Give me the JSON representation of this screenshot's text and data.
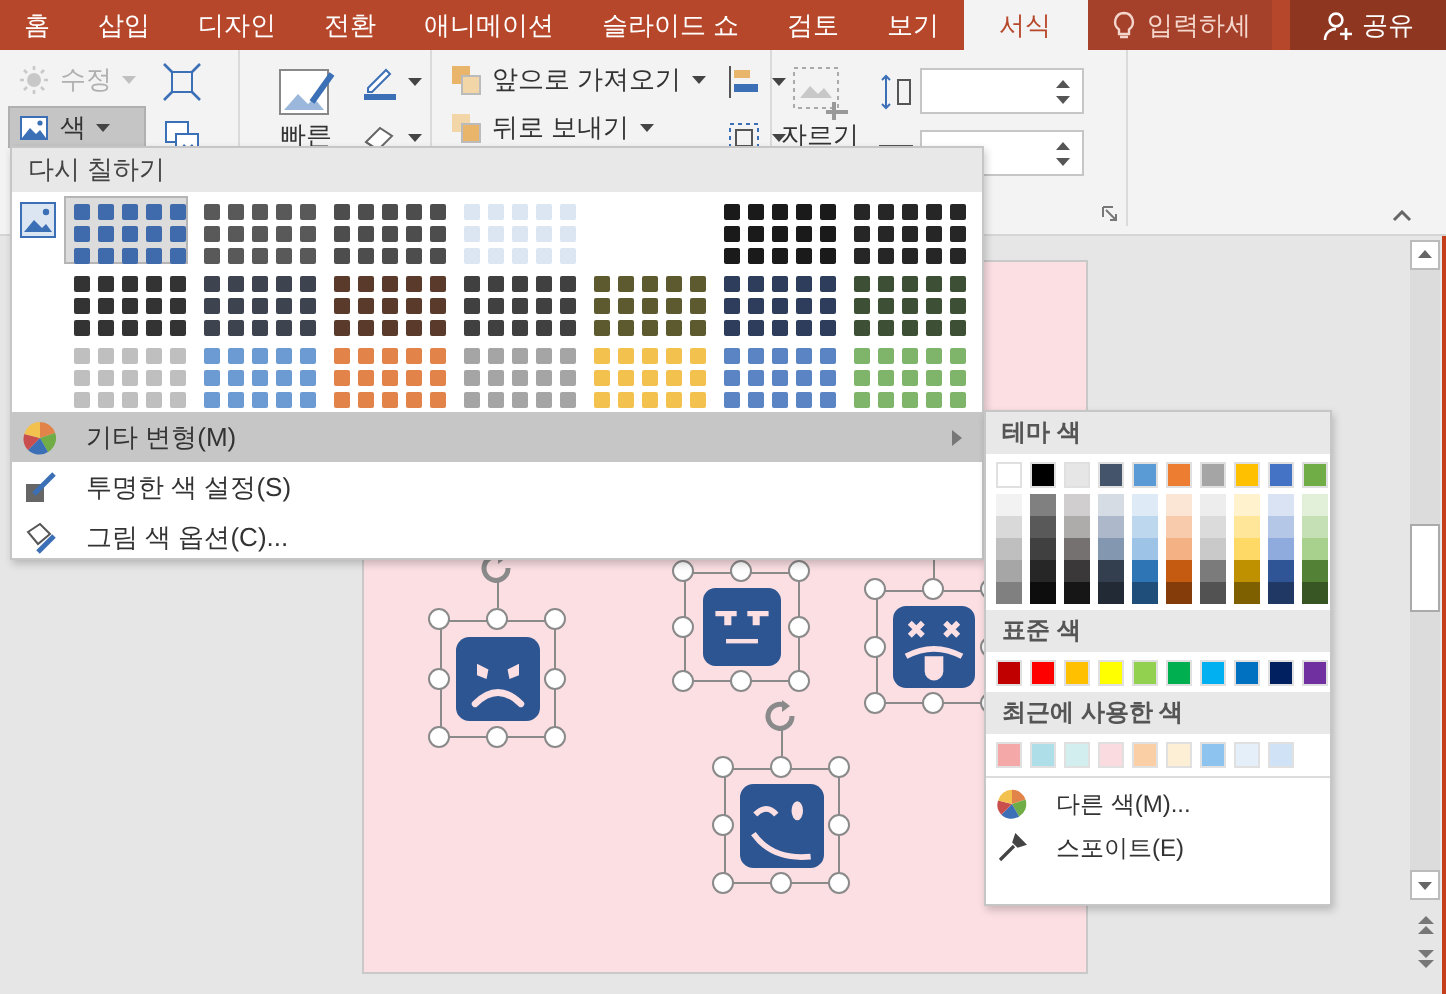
{
  "tabs": [
    {
      "label": "홈",
      "selected": false
    },
    {
      "label": "삽입",
      "selected": false
    },
    {
      "label": "디자인",
      "selected": false
    },
    {
      "label": "전환",
      "selected": false
    },
    {
      "label": "애니메이션",
      "selected": false
    },
    {
      "label": "슬라이드 쇼",
      "selected": false
    },
    {
      "label": "검토",
      "selected": false
    },
    {
      "label": "보기",
      "selected": false
    },
    {
      "label": "서식",
      "selected": true
    }
  ],
  "tell_me": {
    "label": "입력하세"
  },
  "share": {
    "label": "공유"
  },
  "ribbon": {
    "adjust": [
      {
        "label": "수정",
        "disabled": true,
        "pressed": false
      },
      {
        "label": "색",
        "disabled": false,
        "pressed": true
      }
    ],
    "quick_styles": {
      "label": "빠른"
    },
    "arrange": [
      {
        "label": "앞으로 가져오기"
      },
      {
        "label": "뒤로 보내기"
      }
    ],
    "crop": {
      "label": "자르기"
    }
  },
  "recolor_menu": {
    "title": "다시 칠하기",
    "gallery": [
      {
        "options": [
          {
            "color": "#3f6bad",
            "selected": true
          },
          {
            "color": "#595959",
            "selected": false
          },
          {
            "color": "#4d4d4d",
            "selected": false
          },
          {
            "color": "#dce6f2",
            "selected": false
          },
          {
            "color": "#1a1a1a",
            "selected": false
          },
          {
            "color": "#262626",
            "selected": false
          }
        ]
      },
      {
        "options": [
          {
            "color": "#333333",
            "selected": false
          },
          {
            "color": "#3d4450",
            "selected": false
          },
          {
            "color": "#5a3a2a",
            "selected": false
          },
          {
            "color": "#404040",
            "selected": false
          },
          {
            "color": "#5c5a2e",
            "selected": false
          },
          {
            "color": "#2f3d5c",
            "selected": false
          },
          {
            "color": "#3d4f34",
            "selected": false
          }
        ]
      },
      {
        "options": [
          {
            "color": "#bfbfbf",
            "selected": false
          },
          {
            "color": "#6b9bd2",
            "selected": false
          },
          {
            "color": "#e2844a",
            "selected": false
          },
          {
            "color": "#a5a5a5",
            "selected": false
          },
          {
            "color": "#f2c14e",
            "selected": false
          },
          {
            "color": "#5b84c4",
            "selected": false
          },
          {
            "color": "#7fb56a",
            "selected": false
          }
        ]
      }
    ],
    "items": [
      {
        "kind": "palette",
        "label": "기타 변형(M)",
        "highlighted": true,
        "submenu": true
      },
      {
        "kind": "transparent",
        "label": "투명한 색 설정(S)",
        "highlighted": false,
        "submenu": false
      },
      {
        "kind": "options",
        "label": "그림 색 옵션(C)...",
        "highlighted": false,
        "submenu": false
      }
    ]
  },
  "color_submenu": {
    "theme_title": "테마 색",
    "theme": [
      {
        "color": "#ffffff",
        "shades": [
          {
            "color": "#f2f2f2"
          },
          {
            "color": "#d9d9d9"
          },
          {
            "color": "#bfbfbf"
          },
          {
            "color": "#a6a6a6"
          },
          {
            "color": "#808080"
          }
        ]
      },
      {
        "color": "#000000",
        "shades": [
          {
            "color": "#808080"
          },
          {
            "color": "#595959"
          },
          {
            "color": "#404040"
          },
          {
            "color": "#262626"
          },
          {
            "color": "#0d0d0d"
          }
        ]
      },
      {
        "color": "#e7e6e6",
        "shades": [
          {
            "color": "#d0cece"
          },
          {
            "color": "#aeabab"
          },
          {
            "color": "#757171"
          },
          {
            "color": "#3a3838"
          },
          {
            "color": "#171616"
          }
        ]
      },
      {
        "color": "#44546a",
        "shades": [
          {
            "color": "#d6dce4"
          },
          {
            "color": "#adb9ca"
          },
          {
            "color": "#8497b0"
          },
          {
            "color": "#333f4f"
          },
          {
            "color": "#222a35"
          }
        ]
      },
      {
        "color": "#5b9bd5",
        "shades": [
          {
            "color": "#deebf6"
          },
          {
            "color": "#bdd7ee"
          },
          {
            "color": "#9dc3e6"
          },
          {
            "color": "#2e75b5"
          },
          {
            "color": "#1e4e79"
          }
        ]
      },
      {
        "color": "#ed7d31",
        "shades": [
          {
            "color": "#fbe5d5"
          },
          {
            "color": "#f7cbac"
          },
          {
            "color": "#f4b183"
          },
          {
            "color": "#c55a11"
          },
          {
            "color": "#843c0b"
          }
        ]
      },
      {
        "color": "#a5a5a5",
        "shades": [
          {
            "color": "#ededed"
          },
          {
            "color": "#dbdbdb"
          },
          {
            "color": "#c9c9c9"
          },
          {
            "color": "#7b7b7b"
          },
          {
            "color": "#525252"
          }
        ]
      },
      {
        "color": "#ffc000",
        "shades": [
          {
            "color": "#fff2cc"
          },
          {
            "color": "#ffe699"
          },
          {
            "color": "#ffd966"
          },
          {
            "color": "#bf9000"
          },
          {
            "color": "#7f6000"
          }
        ]
      },
      {
        "color": "#4472c4",
        "shades": [
          {
            "color": "#dae3f3"
          },
          {
            "color": "#b4c7e7"
          },
          {
            "color": "#8faadc"
          },
          {
            "color": "#2f5597"
          },
          {
            "color": "#203864"
          }
        ]
      },
      {
        "color": "#70ad47",
        "shades": [
          {
            "color": "#e2f0d9"
          },
          {
            "color": "#c5e0b4"
          },
          {
            "color": "#a9d18e"
          },
          {
            "color": "#538135"
          },
          {
            "color": "#375623"
          }
        ]
      }
    ],
    "standard_title": "표준 색",
    "standard": [
      {
        "color": "#c00000"
      },
      {
        "color": "#ff0000"
      },
      {
        "color": "#ffc000"
      },
      {
        "color": "#ffff00"
      },
      {
        "color": "#92d050"
      },
      {
        "color": "#00b050"
      },
      {
        "color": "#00b0f0"
      },
      {
        "color": "#0070c0"
      },
      {
        "color": "#002060"
      },
      {
        "color": "#7030a0"
      }
    ],
    "recent_title": "최근에 사용한 색",
    "recent": [
      {
        "color": "#f4a9a8"
      },
      {
        "color": "#aedfe8"
      },
      {
        "color": "#d3eeee"
      },
      {
        "color": "#fadbe0"
      },
      {
        "color": "#fbcfa6"
      },
      {
        "color": "#fcefd6"
      },
      {
        "color": "#8cc3ef"
      },
      {
        "color": "#e5eff9"
      },
      {
        "color": "#cfe2f6"
      }
    ],
    "actions": [
      {
        "kind": "more",
        "label": "다른 색(M)..."
      },
      {
        "kind": "eyedropper",
        "label": "스포이트(E)"
      }
    ]
  },
  "slide": {
    "shapes": [
      {
        "kind": "angry",
        "selected": true
      },
      {
        "kind": "neutral",
        "selected": true
      },
      {
        "kind": "dead",
        "selected": true
      },
      {
        "kind": "wink",
        "selected": true
      }
    ]
  }
}
